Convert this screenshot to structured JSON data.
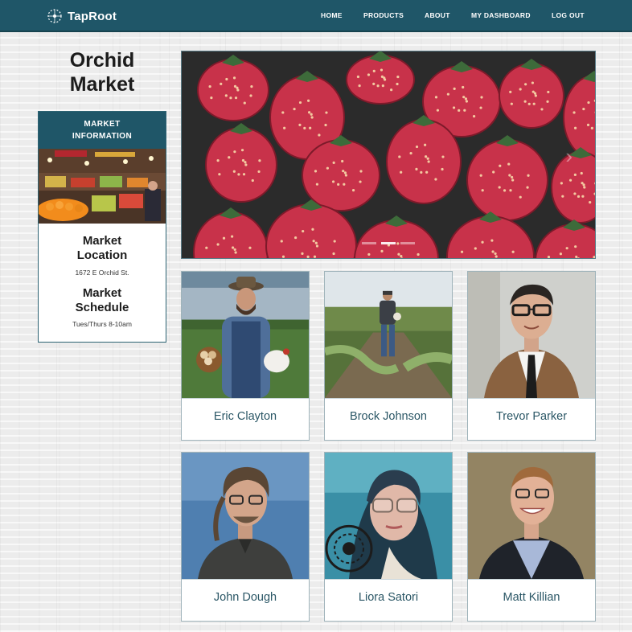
{
  "brand": {
    "name": "TapRoot",
    "icon": "taproot-logo-icon"
  },
  "nav": {
    "home": "HOME",
    "products": "PRODUCTS",
    "about": "ABOUT",
    "dashboard": "MY DASHBOARD",
    "logout": "LOG OUT"
  },
  "market": {
    "title_line1": "Orchid",
    "title_line2": "Market",
    "info_header_line1": "MARKET",
    "info_header_line2": "INFORMATION",
    "location_heading_line1": "Market",
    "location_heading_line2": "Location",
    "location_value": "1672 E Orchid St.",
    "schedule_heading_line1": "Market",
    "schedule_heading_line2": "Schedule",
    "schedule_value": "Tues/Thurs 8-10am"
  },
  "carousel": {
    "slide_count": 3,
    "active_index": 1,
    "image": "strawberries"
  },
  "vendors": [
    {
      "name": "Eric Clayton"
    },
    {
      "name": "Brock Johnson"
    },
    {
      "name": "Trevor Parker"
    },
    {
      "name": "John Dough"
    },
    {
      "name": "Liora Satori"
    },
    {
      "name": "Matt Killian"
    }
  ],
  "colors": {
    "primary": "#1f5668",
    "vendor_name": "#2b5766",
    "strawberry": "#c8324a"
  }
}
